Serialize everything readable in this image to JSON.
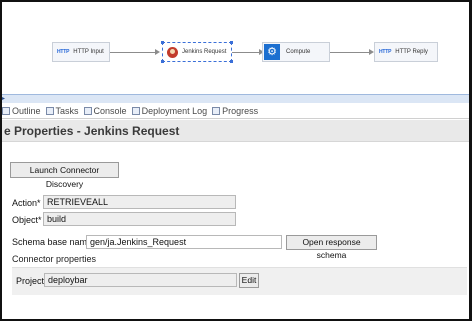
{
  "canvas": {
    "nodes": [
      {
        "icon": "HTTP",
        "label": "HTTP Input"
      },
      {
        "icon": "jenkins",
        "label": "Jenkins Request"
      },
      {
        "icon": "compute",
        "label": "Compute"
      },
      {
        "icon": "HTTP",
        "label": "HTTP Reply"
      }
    ]
  },
  "tabs": [
    "Outline",
    "Tasks",
    "Console",
    "Deployment Log",
    "Progress"
  ],
  "properties": {
    "title": "e Properties - Jenkins Request",
    "launch_button": "Launch Connector Discovery",
    "action_label": "Action*",
    "action_value": "RETRIEVEALL",
    "object_label": "Object*",
    "object_value": "build",
    "schema_label": "Schema base name*",
    "schema_value": "gen/ja.Jenkins_Request",
    "open_schema_button": "Open response schema",
    "connector_section": "Connector properties",
    "project_label": "Project",
    "project_value": "deploybar",
    "edit_button": "Edit"
  },
  "colors": {
    "accent": "#1c6fd0",
    "selection": "#3a6fd8",
    "jenkins": "#c23b2b",
    "separator": "#dbe6f5"
  }
}
